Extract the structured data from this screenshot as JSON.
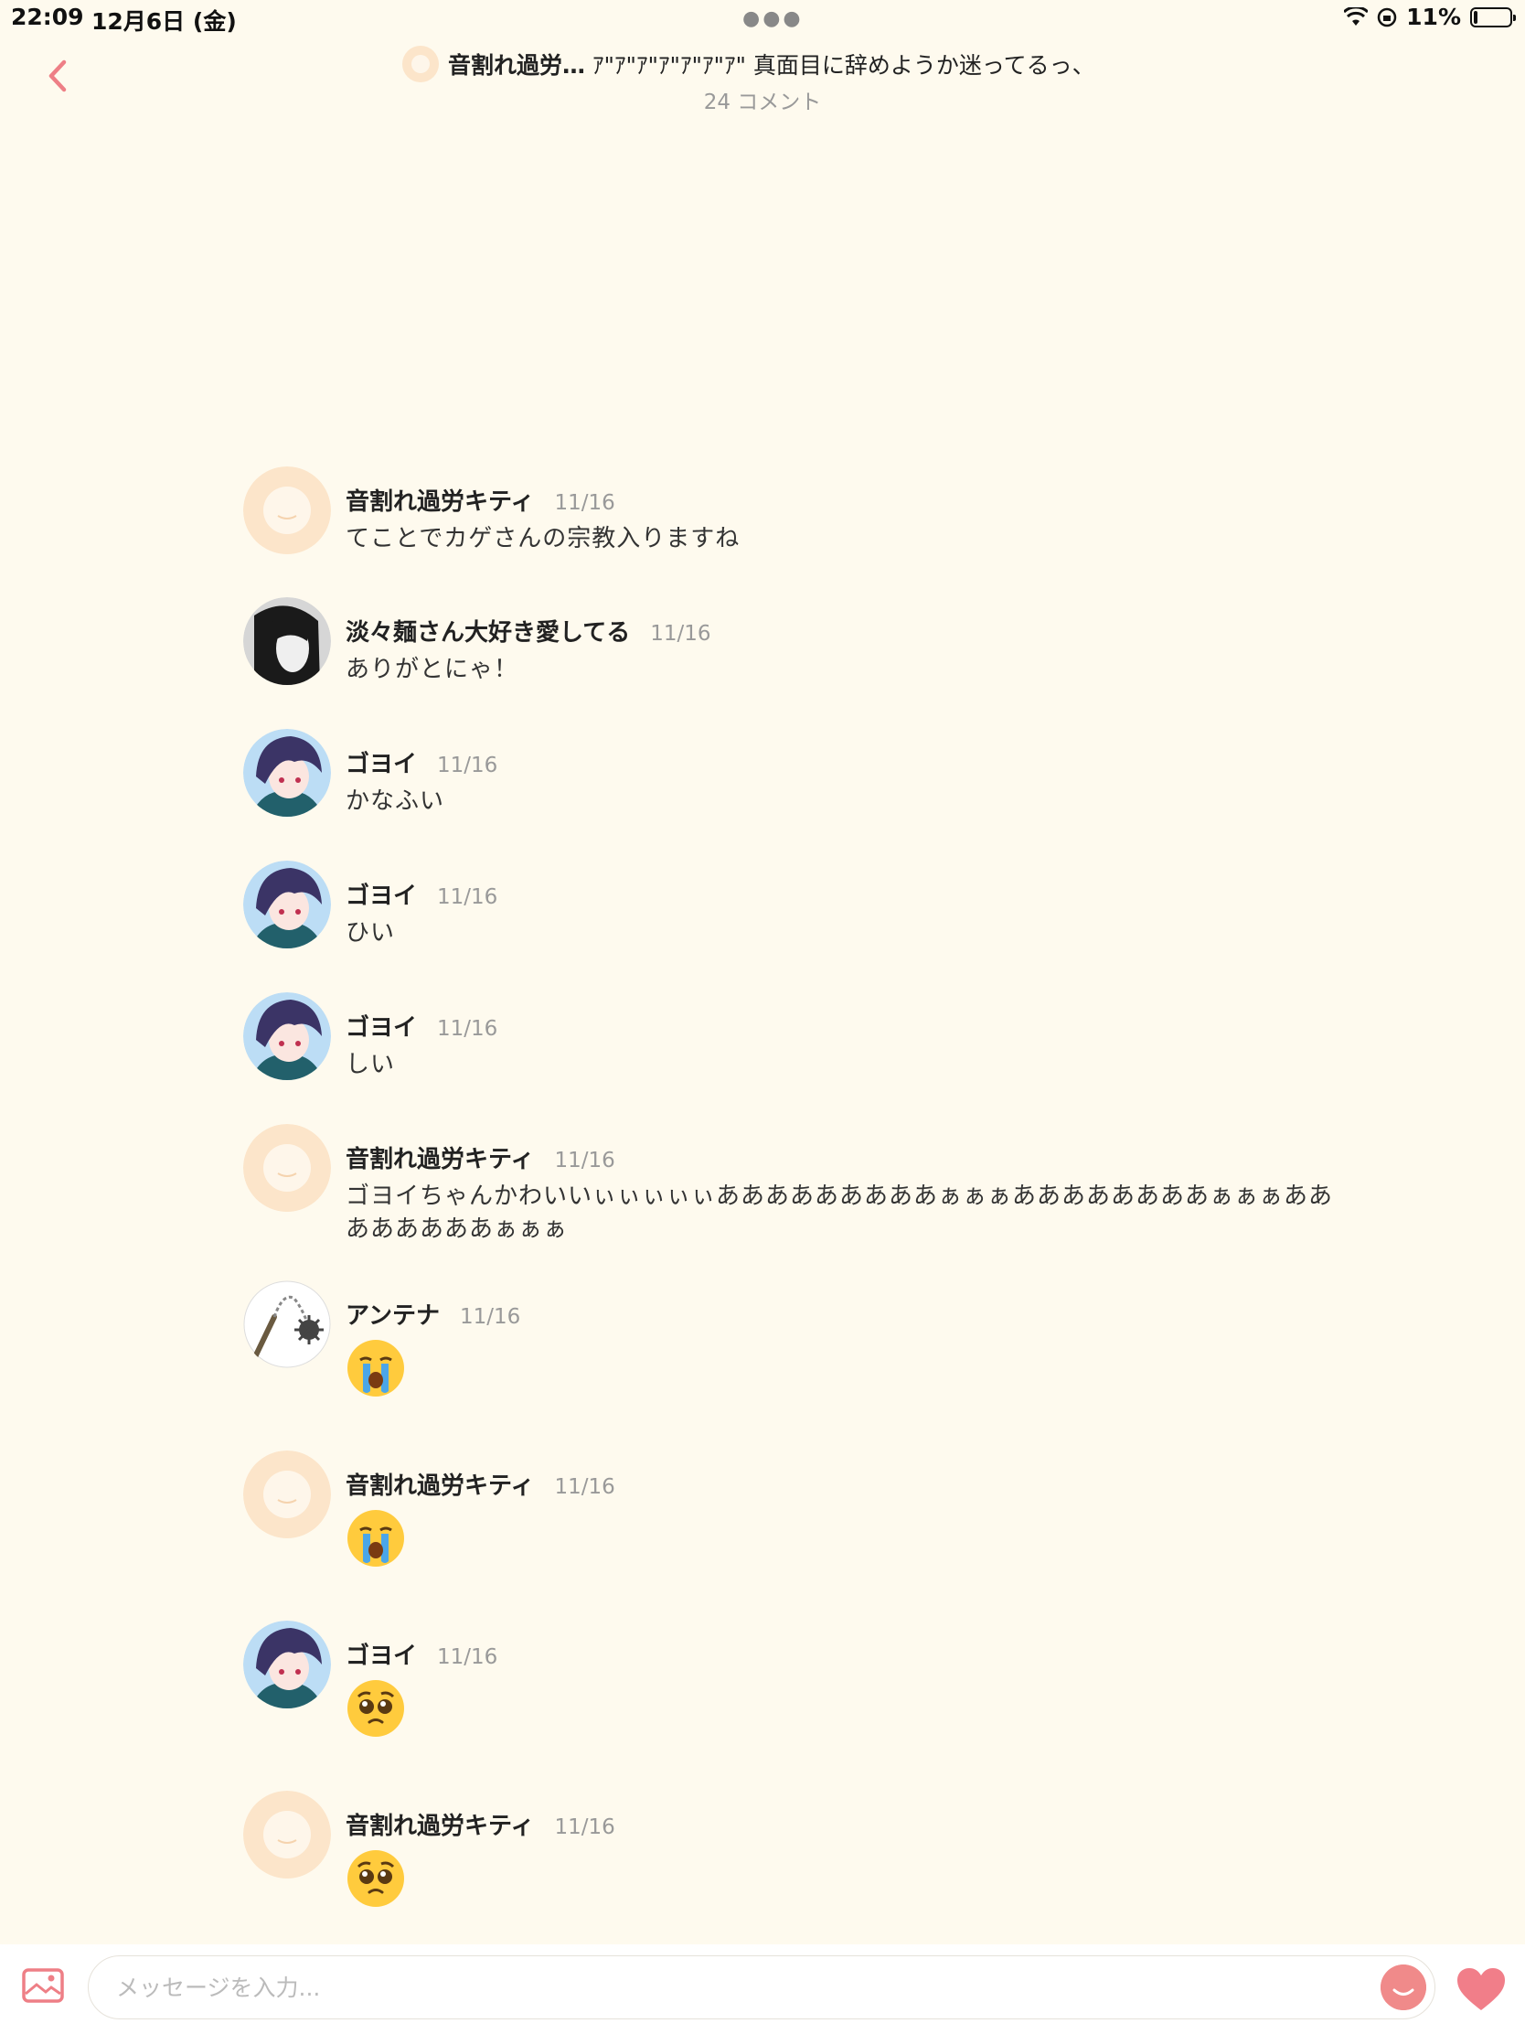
{
  "status_bar": {
    "time": "22:09",
    "date": "12月6日 (金)",
    "battery": "11%",
    "battery_level": 0.11
  },
  "header": {
    "title_bold": "音割れ過労…",
    "title_rest": " ｱ\"ｱ\"ｱ\"ｱ\"ｱ\"ｱ\"ｱ\" 真面目に辞めようか迷ってるっ、",
    "subtitle": "24 コメント"
  },
  "messages": [
    {
      "user": "音割れ過労キティ",
      "time": "11/16",
      "text": "てことでカゲさんの宗教入りますね",
      "avatar": "default-avatar"
    },
    {
      "user": "淡々麺さん大好き愛してる",
      "time": "11/16",
      "text": "ありがとにゃ！",
      "avatar": "dark-avatar"
    },
    {
      "user": "ゴヨイ",
      "time": "11/16",
      "text": "かなふい",
      "avatar": "purple-hair-avatar"
    },
    {
      "user": "ゴヨイ",
      "time": "11/16",
      "text": "ひい",
      "avatar": "purple-hair-avatar"
    },
    {
      "user": "ゴヨイ",
      "time": "11/16",
      "text": "しい",
      "avatar": "purple-hair-avatar"
    },
    {
      "user": "音割れ過労キティ",
      "time": "11/16",
      "text": "ゴヨイちゃんかわいいぃぃぃぃぃあああああああああぁぁぁああああああああぁぁぁああ\nああああああぁぁぁ",
      "avatar": "default-avatar"
    },
    {
      "user": "アンテナ",
      "time": "11/16",
      "emoji": "loudly-crying-face-emoji",
      "avatar": "flail-avatar"
    },
    {
      "user": "音割れ過労キティ",
      "time": "11/16",
      "emoji": "loudly-crying-face-emoji",
      "avatar": "default-avatar"
    },
    {
      "user": "ゴヨイ",
      "time": "11/16",
      "emoji": "pleading-face-emoji",
      "avatar": "purple-hair-avatar"
    },
    {
      "user": "音割れ過労キティ",
      "time": "11/16",
      "emoji": "pleading-face-emoji",
      "avatar": "default-avatar"
    }
  ],
  "input": {
    "placeholder": "メッセージを入力..."
  },
  "colors": {
    "background": "#FEFAEE",
    "accent": "#EE7F86",
    "default_avatar": "#FCE5CA"
  }
}
